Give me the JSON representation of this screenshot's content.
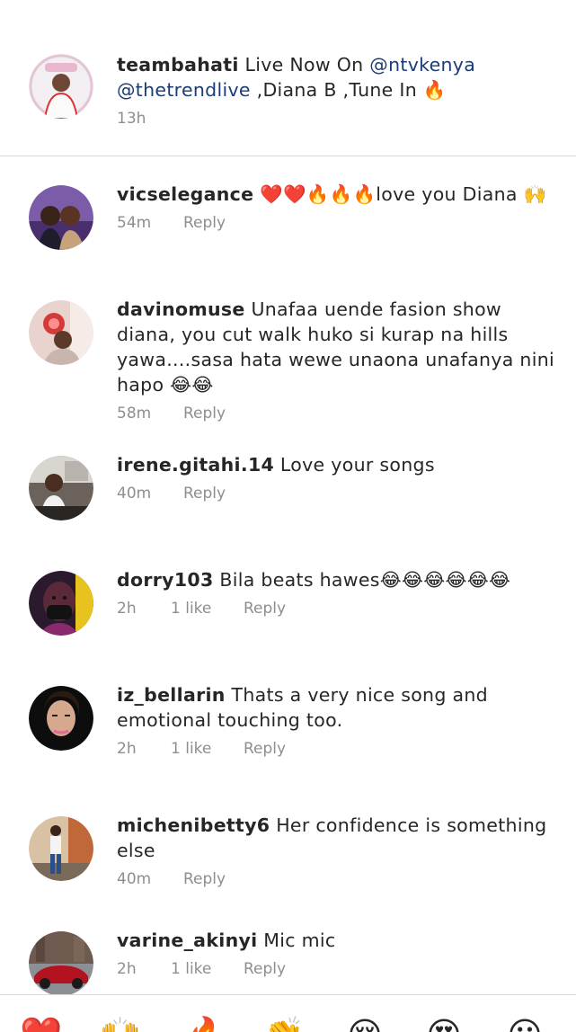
{
  "caption": {
    "username": "teambahati",
    "text_before": " Live Now On ",
    "mention1": "@ntvkenya",
    "mention2": "@thetrendlive",
    "text_after": " ,Diana B ,Tune In 🔥",
    "time": "13h"
  },
  "comments": [
    {
      "username": "vicselegance",
      "text": " ❤️❤️🔥🔥🔥love you Diana 🙌",
      "time": "54m",
      "likes": "",
      "reply": "Reply"
    },
    {
      "username": "davinomuse",
      "text": " Unafaa uende fasion show diana, you cut walk huko si kurap na hills  yawa....sasa hata wewe unaona unafanya nini hapo 😂😂",
      "time": "58m",
      "likes": "",
      "reply": "Reply"
    },
    {
      "username": "irene.gitahi.14",
      "text": " Love your songs",
      "time": "40m",
      "likes": "",
      "reply": "Reply"
    },
    {
      "username": "dorry103",
      "text": " Bila beats hawes😂😂😂😂😂😂",
      "time": "2h",
      "likes": "1 like",
      "reply": "Reply"
    },
    {
      "username": "iz_bellarin",
      "text": " Thats a very nice song and emotional touching too.",
      "time": "2h",
      "likes": "1 like",
      "reply": "Reply"
    },
    {
      "username": "michenibetty6",
      "text": " Her confidence is something else",
      "time": "40m",
      "likes": "",
      "reply": "Reply"
    },
    {
      "username": "varine_akinyi",
      "text": " Mic mic",
      "time": "2h",
      "likes": "1 like",
      "reply": "Reply"
    }
  ],
  "reactions": [
    "❤️",
    "🙌",
    "🔥",
    "👏",
    "😢",
    "😍",
    "😮"
  ],
  "colors": {
    "mention": "#1b3c75",
    "meta": "#8e8e8e",
    "divider": "#dbdbdb"
  }
}
